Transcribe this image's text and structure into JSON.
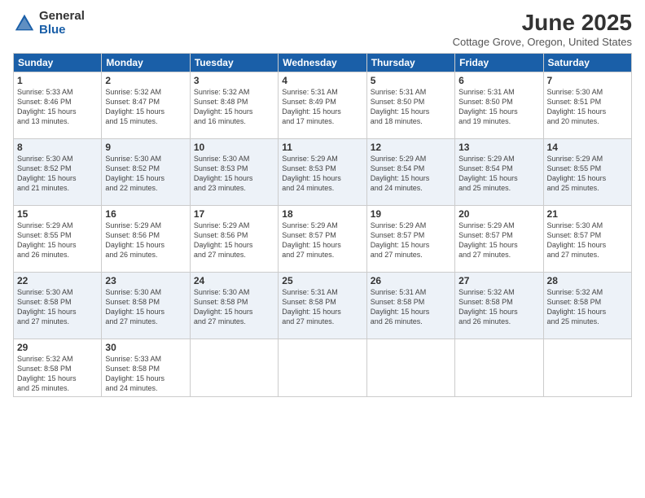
{
  "logo": {
    "general": "General",
    "blue": "Blue"
  },
  "title": "June 2025",
  "location": "Cottage Grove, Oregon, United States",
  "headers": [
    "Sunday",
    "Monday",
    "Tuesday",
    "Wednesday",
    "Thursday",
    "Friday",
    "Saturday"
  ],
  "weeks": [
    [
      {
        "num": "1",
        "info": "Sunrise: 5:33 AM\nSunset: 8:46 PM\nDaylight: 15 hours\nand 13 minutes."
      },
      {
        "num": "2",
        "info": "Sunrise: 5:32 AM\nSunset: 8:47 PM\nDaylight: 15 hours\nand 15 minutes."
      },
      {
        "num": "3",
        "info": "Sunrise: 5:32 AM\nSunset: 8:48 PM\nDaylight: 15 hours\nand 16 minutes."
      },
      {
        "num": "4",
        "info": "Sunrise: 5:31 AM\nSunset: 8:49 PM\nDaylight: 15 hours\nand 17 minutes."
      },
      {
        "num": "5",
        "info": "Sunrise: 5:31 AM\nSunset: 8:50 PM\nDaylight: 15 hours\nand 18 minutes."
      },
      {
        "num": "6",
        "info": "Sunrise: 5:31 AM\nSunset: 8:50 PM\nDaylight: 15 hours\nand 19 minutes."
      },
      {
        "num": "7",
        "info": "Sunrise: 5:30 AM\nSunset: 8:51 PM\nDaylight: 15 hours\nand 20 minutes."
      }
    ],
    [
      {
        "num": "8",
        "info": "Sunrise: 5:30 AM\nSunset: 8:52 PM\nDaylight: 15 hours\nand 21 minutes."
      },
      {
        "num": "9",
        "info": "Sunrise: 5:30 AM\nSunset: 8:52 PM\nDaylight: 15 hours\nand 22 minutes."
      },
      {
        "num": "10",
        "info": "Sunrise: 5:30 AM\nSunset: 8:53 PM\nDaylight: 15 hours\nand 23 minutes."
      },
      {
        "num": "11",
        "info": "Sunrise: 5:29 AM\nSunset: 8:53 PM\nDaylight: 15 hours\nand 24 minutes."
      },
      {
        "num": "12",
        "info": "Sunrise: 5:29 AM\nSunset: 8:54 PM\nDaylight: 15 hours\nand 24 minutes."
      },
      {
        "num": "13",
        "info": "Sunrise: 5:29 AM\nSunset: 8:54 PM\nDaylight: 15 hours\nand 25 minutes."
      },
      {
        "num": "14",
        "info": "Sunrise: 5:29 AM\nSunset: 8:55 PM\nDaylight: 15 hours\nand 25 minutes."
      }
    ],
    [
      {
        "num": "15",
        "info": "Sunrise: 5:29 AM\nSunset: 8:55 PM\nDaylight: 15 hours\nand 26 minutes."
      },
      {
        "num": "16",
        "info": "Sunrise: 5:29 AM\nSunset: 8:56 PM\nDaylight: 15 hours\nand 26 minutes."
      },
      {
        "num": "17",
        "info": "Sunrise: 5:29 AM\nSunset: 8:56 PM\nDaylight: 15 hours\nand 27 minutes."
      },
      {
        "num": "18",
        "info": "Sunrise: 5:29 AM\nSunset: 8:57 PM\nDaylight: 15 hours\nand 27 minutes."
      },
      {
        "num": "19",
        "info": "Sunrise: 5:29 AM\nSunset: 8:57 PM\nDaylight: 15 hours\nand 27 minutes."
      },
      {
        "num": "20",
        "info": "Sunrise: 5:29 AM\nSunset: 8:57 PM\nDaylight: 15 hours\nand 27 minutes."
      },
      {
        "num": "21",
        "info": "Sunrise: 5:30 AM\nSunset: 8:57 PM\nDaylight: 15 hours\nand 27 minutes."
      }
    ],
    [
      {
        "num": "22",
        "info": "Sunrise: 5:30 AM\nSunset: 8:58 PM\nDaylight: 15 hours\nand 27 minutes."
      },
      {
        "num": "23",
        "info": "Sunrise: 5:30 AM\nSunset: 8:58 PM\nDaylight: 15 hours\nand 27 minutes."
      },
      {
        "num": "24",
        "info": "Sunrise: 5:30 AM\nSunset: 8:58 PM\nDaylight: 15 hours\nand 27 minutes."
      },
      {
        "num": "25",
        "info": "Sunrise: 5:31 AM\nSunset: 8:58 PM\nDaylight: 15 hours\nand 27 minutes."
      },
      {
        "num": "26",
        "info": "Sunrise: 5:31 AM\nSunset: 8:58 PM\nDaylight: 15 hours\nand 26 minutes."
      },
      {
        "num": "27",
        "info": "Sunrise: 5:32 AM\nSunset: 8:58 PM\nDaylight: 15 hours\nand 26 minutes."
      },
      {
        "num": "28",
        "info": "Sunrise: 5:32 AM\nSunset: 8:58 PM\nDaylight: 15 hours\nand 25 minutes."
      }
    ],
    [
      {
        "num": "29",
        "info": "Sunrise: 5:32 AM\nSunset: 8:58 PM\nDaylight: 15 hours\nand 25 minutes."
      },
      {
        "num": "30",
        "info": "Sunrise: 5:33 AM\nSunset: 8:58 PM\nDaylight: 15 hours\nand 24 minutes."
      },
      {
        "num": "",
        "info": ""
      },
      {
        "num": "",
        "info": ""
      },
      {
        "num": "",
        "info": ""
      },
      {
        "num": "",
        "info": ""
      },
      {
        "num": "",
        "info": ""
      }
    ]
  ]
}
